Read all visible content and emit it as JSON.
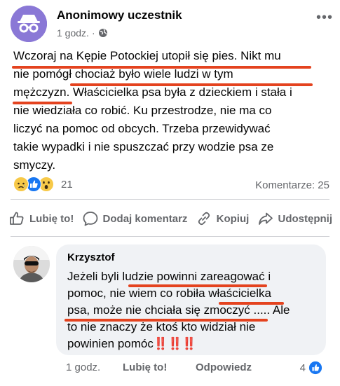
{
  "post": {
    "author": "Anonimowy uczestnik",
    "time": "1 godz.",
    "more": "•••",
    "text_lines": [
      "Wczoraj na Kępie Potockiej utopił się pies. Nikt mu",
      "nie pomógł  chociaż było wiele ludzi w tym",
      "mężczyzn. Właścicielka psa była z dzieckiem i stała i",
      "nie wiedziała co robić. Ku przestrodze, nie ma co",
      "liczyć na pomoc od obcych. Trzeba przewidywać",
      "takie wypadki i nie spuszczać przy wodzie psa ze",
      "smyczy."
    ],
    "reaction_count": "21",
    "comments_label": "Komentarze: 25",
    "reaction_icons": [
      "sad-reaction-icon",
      "like-reaction-icon",
      "wow-reaction-icon"
    ]
  },
  "actions": {
    "like": "Lubię to!",
    "comment": "Dodaj komentarz",
    "copy": "Kopiuj",
    "share": "Udostępnij"
  },
  "comment": {
    "author": "Krzysztof",
    "text_lines": [
      "Jeżeli byli ludzie powinni zareagować i",
      "pomoc, nie wiem co robiła właścicielka",
      "psa, może nie chciała się zmoczyć ..... Ale",
      "to nie znaczy że ktoś kto widział nie",
      "powinien pomóc"
    ],
    "emphasis": "‼️‼️‼️",
    "time": "1 godz.",
    "like_label": "Lubię to!",
    "reply_label": "Odpowiedz",
    "like_count": "4"
  },
  "colors": {
    "underline": "#e4431f",
    "meta": "#65676b",
    "anon_avatar": "#8a78d6",
    "like_blue": "#1877f2",
    "bubble": "#f0f2f5"
  }
}
